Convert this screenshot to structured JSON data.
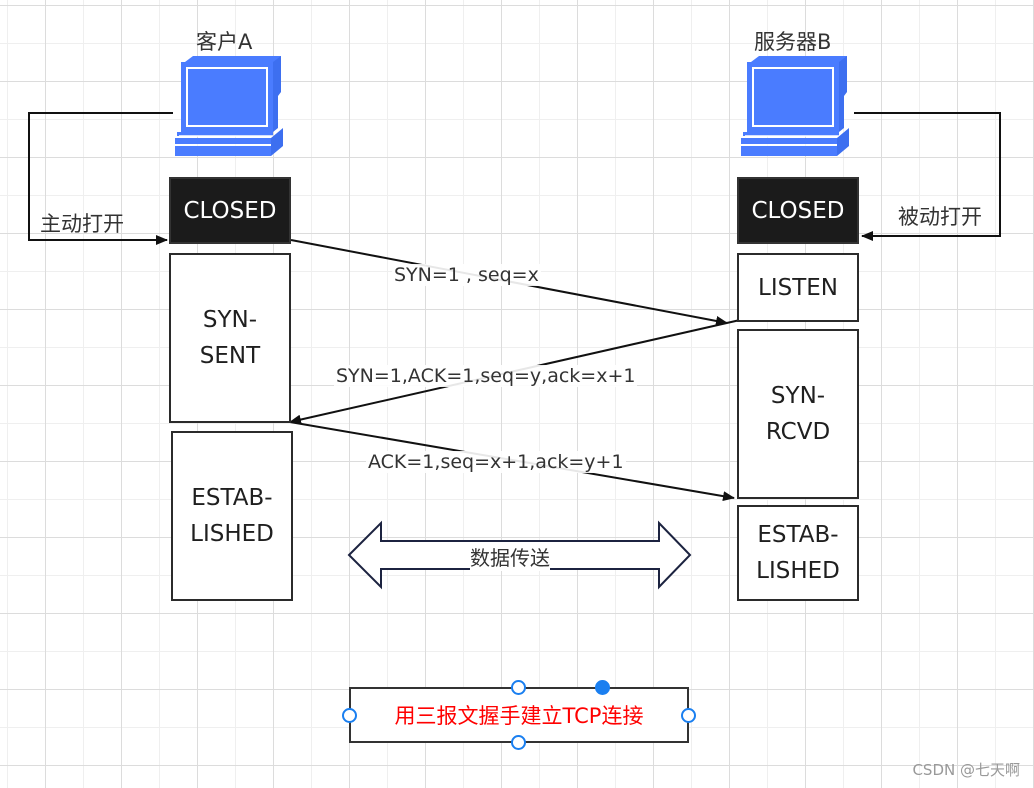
{
  "diagram": {
    "title": "用三报文握手建立TCP连接",
    "client": {
      "name": "客户A",
      "open_label": "主动打开",
      "states": [
        "CLOSED",
        "SYN-\nSENT",
        "ESTAB-\nLISHED"
      ]
    },
    "server": {
      "name": "服务器B",
      "open_label": "被动打开",
      "states": [
        "CLOSED",
        "LISTEN",
        "SYN-\nRCVD",
        "ESTAB-\nLISHED"
      ]
    },
    "messages": [
      {
        "from": "客户A",
        "to": "服务器B",
        "label": "SYN=1 , seq=x"
      },
      {
        "from": "服务器B",
        "to": "客户A",
        "label": "SYN=1,ACK=1,seq=y,ack=x+1"
      },
      {
        "from": "客户A",
        "to": "服务器B",
        "label": "ACK=1,seq=x+1,ack=y+1"
      }
    ],
    "data_transfer_label": "数据传送",
    "icons": {
      "client": "computer-icon",
      "server": "computer-icon"
    },
    "colors": {
      "computer": "#4a7cff",
      "closed_fill": "#1b1b1b",
      "caption_text": "#ff0000",
      "selection_handle": "#1a7ff0"
    }
  },
  "watermark": "CSDN @七天啊"
}
